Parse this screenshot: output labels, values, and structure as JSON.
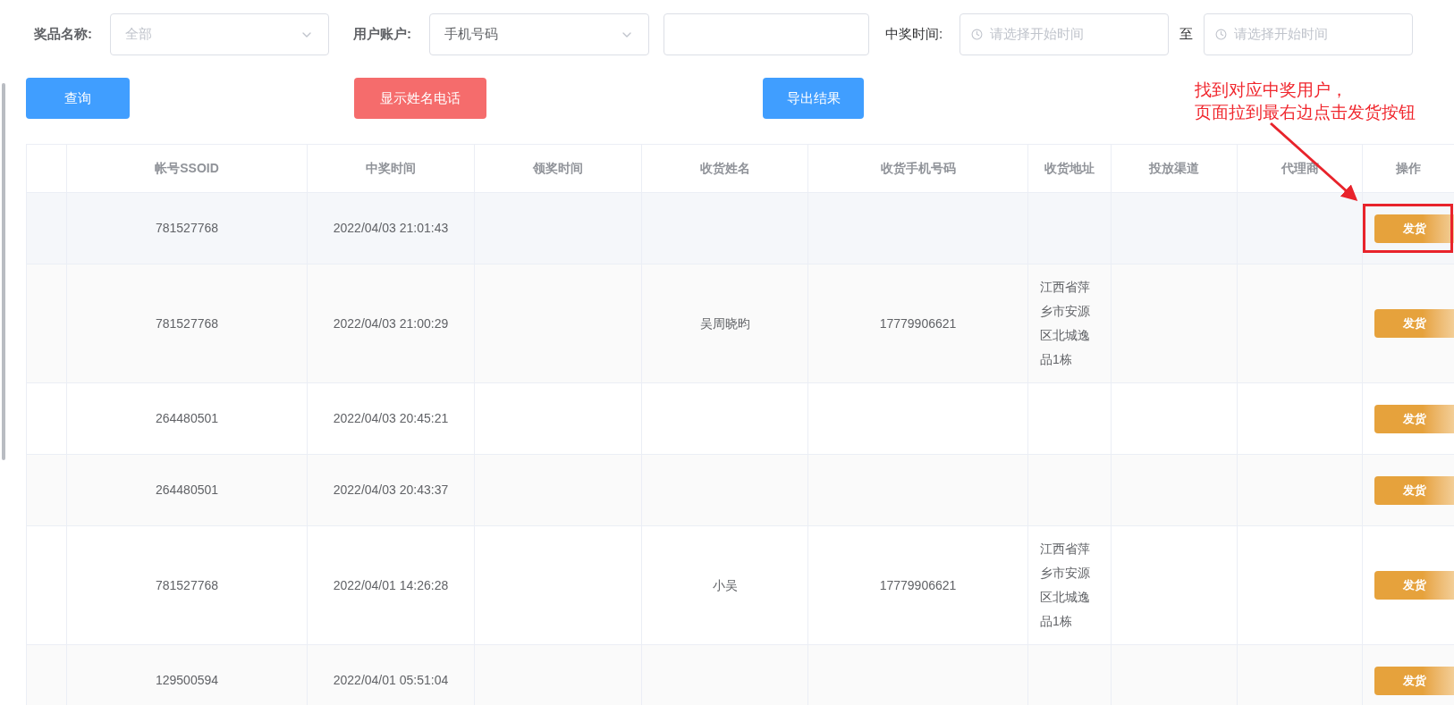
{
  "filters": {
    "prize_label": "奖品名称:",
    "prize_select": {
      "value": "全部",
      "is_placeholder": true
    },
    "account_label": "用户账户:",
    "account_select": {
      "value": "手机号码",
      "is_placeholder": false
    },
    "win_time_label": "中奖时间:",
    "start_placeholder": "请选择开始时间",
    "range_separator": "至",
    "end_placeholder": "请选择开始时间"
  },
  "buttons": [
    {
      "label": "查询",
      "kind": "primary"
    },
    {
      "label": "显示姓名电话",
      "kind": "danger"
    },
    {
      "label": "导出结果",
      "kind": "primary"
    }
  ],
  "table": {
    "columns": [
      "帐号SSOID",
      "中奖时间",
      "领奖时间",
      "收货姓名",
      "收货手机号码",
      "收货地址",
      "投放渠道",
      "代理商",
      "操作"
    ],
    "rows": [
      {
        "cells": [
          "781527768",
          "2022/04/03 21:01:43",
          null,
          null,
          null,
          null,
          null,
          null
        ],
        "action": "发货",
        "highlighted": true,
        "annotated": true
      },
      {
        "cells": [
          "781527768",
          "2022/04/03 21:00:29",
          null,
          "吴周晓昀",
          "17779906621",
          "江西省萍乡市安源区北城逸品1栋",
          null,
          null
        ],
        "action": "发货",
        "highlighted": false,
        "annotated": false
      },
      {
        "cells": [
          "264480501",
          "2022/04/03 20:45:21",
          null,
          null,
          null,
          null,
          null,
          null
        ],
        "action": "发货",
        "highlighted": false,
        "annotated": false
      },
      {
        "cells": [
          "264480501",
          "2022/04/03 20:43:37",
          null,
          null,
          null,
          null,
          null,
          null
        ],
        "action": "发货",
        "highlighted": false,
        "annotated": false
      },
      {
        "cells": [
          "781527768",
          "2022/04/01 14:26:28",
          null,
          "小吴",
          "17779906621",
          "江西省萍乡市安源区北城逸品1栋",
          null,
          null
        ],
        "action": "发货",
        "highlighted": false,
        "annotated": false
      },
      {
        "cells": [
          "129500594",
          "2022/04/01 05:51:04",
          null,
          null,
          null,
          null,
          null,
          null
        ],
        "action": "发货",
        "highlighted": false,
        "annotated": false
      }
    ]
  },
  "annotation": {
    "lines": [
      "找到对应中奖用户，",
      "页面拉到最右边点击发货按钮"
    ]
  }
}
